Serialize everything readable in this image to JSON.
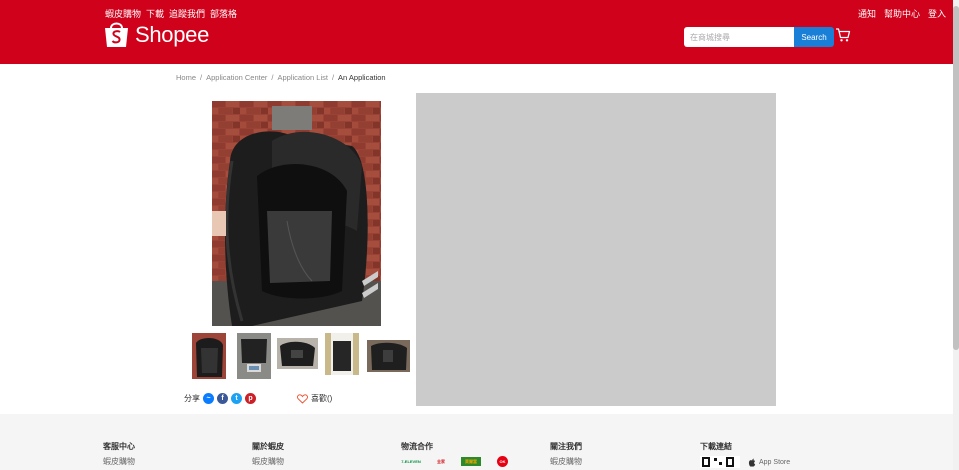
{
  "header": {
    "left_links": [
      "蝦皮購物",
      "下載",
      "追蹤我們",
      "部落格"
    ],
    "right_links": [
      "通知",
      "幫助中心",
      "登入"
    ],
    "logo_text": "Shopee",
    "search_placeholder": "在商城搜尋",
    "search_button": "Search"
  },
  "breadcrumb": {
    "items": [
      "Home",
      "Application Center",
      "Application List"
    ],
    "current": "An Application"
  },
  "share": {
    "label": "分享"
  },
  "like": {
    "label": "喜歡()"
  },
  "footer": {
    "columns": [
      {
        "heading": "客服中心",
        "item": "蝦皮購物"
      },
      {
        "heading": "關於蝦皮",
        "item": "蝦皮購物"
      },
      {
        "heading": "物流合作",
        "logos": [
          "7-ELEVEN",
          "全家",
          "萊爾富",
          "OK"
        ]
      },
      {
        "heading": "關注我們",
        "item": "蝦皮購物"
      },
      {
        "heading": "下載連結",
        "item": "App Store"
      }
    ]
  },
  "colors": {
    "brand": "#d0011b",
    "search_button": "#1a7fd6",
    "placeholder_block": "#cbcbcb"
  }
}
